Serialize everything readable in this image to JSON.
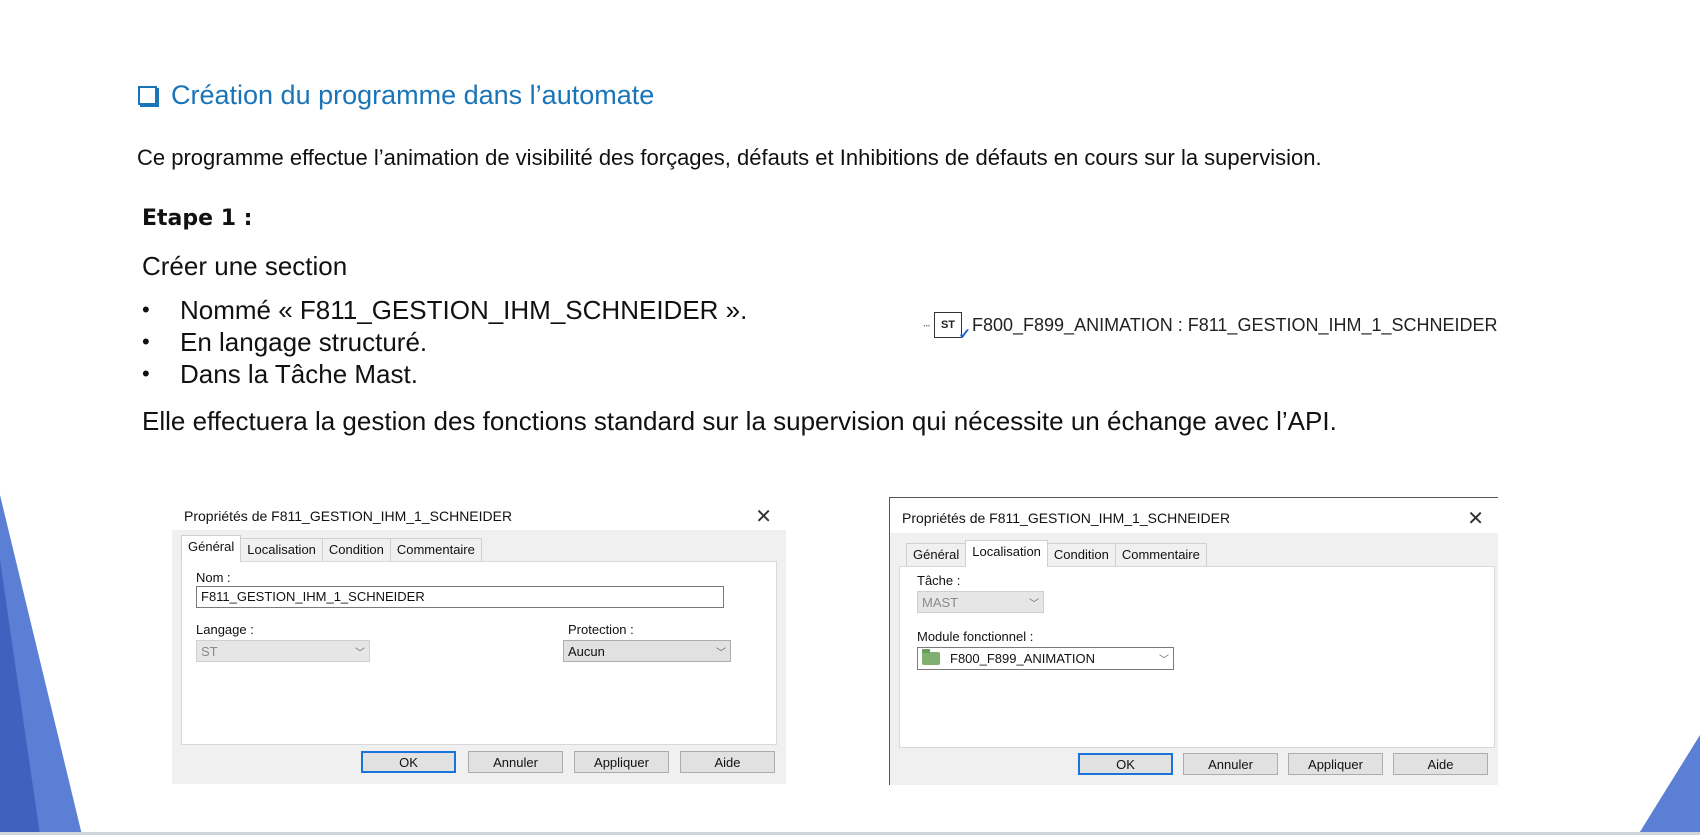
{
  "title": "Création du programme dans l’automate",
  "intro": "Ce programme effectue l’animation de visibilité des forçages, défauts et Inhibitions de défauts en cours sur la supervision.",
  "step": "Etape 1 :",
  "create": "Créer une section",
  "bullets": [
    "Nommé « F811_GESTION_IHM_SCHNEIDER ».",
    "En langage structuré.",
    "Dans la Tâche Mast."
  ],
  "effect": "Elle effectuera la gestion des fonctions standard sur la supervision qui nécessite un échange avec l’API.",
  "section_ref": {
    "icon_text": "ST",
    "label": "F800_F899_ANIMATION : F811_GESTION_IHM_1_SCHNEIDER"
  },
  "dialog1": {
    "title": "Propriétés de F811_GESTION_IHM_1_SCHNEIDER",
    "tabs": [
      "Général",
      "Localisation",
      "Condition",
      "Commentaire"
    ],
    "active_tab": "Général",
    "name_label": "Nom :",
    "name_value": "F811_GESTION_IHM_1_SCHNEIDER",
    "language_label": "Langage :",
    "language_value": "ST",
    "protection_label": "Protection :",
    "protection_value": "Aucun",
    "buttons": [
      "OK",
      "Annuler",
      "Appliquer",
      "Aide"
    ]
  },
  "dialog2": {
    "title": "Propriétés de F811_GESTION_IHM_1_SCHNEIDER",
    "tabs": [
      "Général",
      "Localisation",
      "Condition",
      "Commentaire"
    ],
    "active_tab": "Localisation",
    "task_label": "Tâche :",
    "task_value": "MAST",
    "module_label": "Module fonctionnel :",
    "module_value": "F800_F899_ANIMATION",
    "buttons": [
      "OK",
      "Annuler",
      "Appliquer",
      "Aide"
    ]
  },
  "colors": {
    "title": "#1a74b8",
    "accent": "#5b7fd4"
  }
}
